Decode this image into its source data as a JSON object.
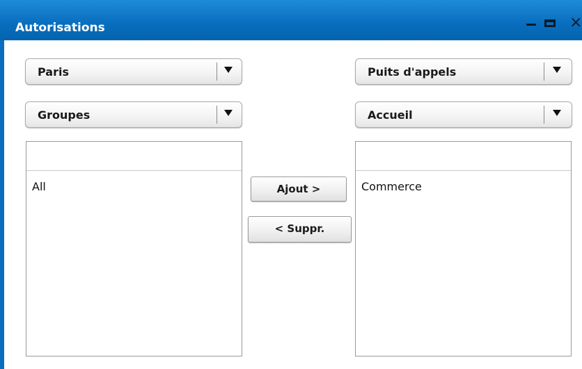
{
  "window": {
    "title": "Autorisations",
    "controls": {
      "minimize": "_",
      "maximize": "□",
      "close": "×"
    }
  },
  "left": {
    "site_select": {
      "value": "Paris"
    },
    "type_select": {
      "value": "Groupes"
    },
    "list": {
      "header": "",
      "items": [
        "All"
      ]
    }
  },
  "right": {
    "queue_select": {
      "value": "Puits d'appels"
    },
    "group_select": {
      "value": "Accueil"
    },
    "list": {
      "header": "",
      "items": [
        "Commerce"
      ]
    }
  },
  "actions": {
    "add_label": "Ajout >",
    "remove_label": "< Suppr."
  },
  "colors": {
    "titlebar": "#0a6fc0",
    "title_text": "#ffffff"
  }
}
